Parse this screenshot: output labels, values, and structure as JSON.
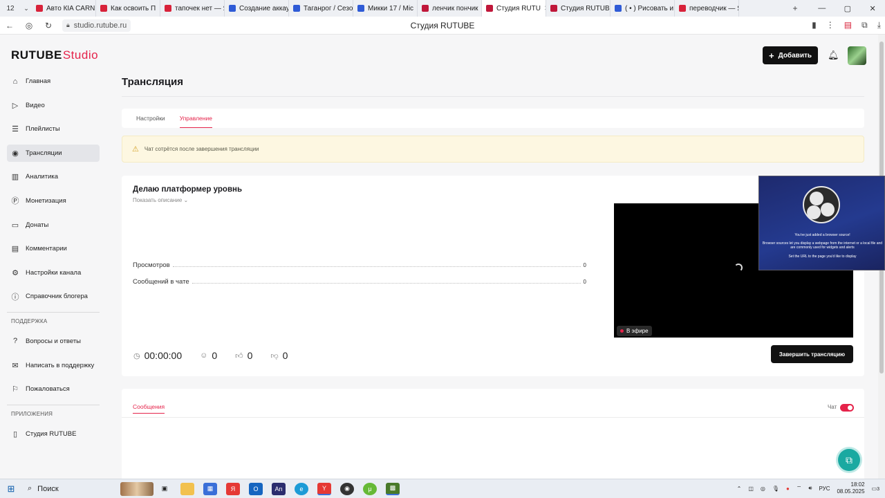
{
  "browser": {
    "tab_count": "12",
    "tabs": [
      {
        "label": "Авто КIA CARNI",
        "color": "#d8223a",
        "active": false
      },
      {
        "label": "Как освоить П",
        "color": "#d8223a",
        "active": false
      },
      {
        "label": "тапочек нет — Я",
        "color": "#d8223a",
        "active": false
      },
      {
        "label": "Создание аккау",
        "color": "#2f5bd6",
        "active": false
      },
      {
        "label": "Таганрог / Сезо",
        "color": "#2f5bd6",
        "active": false
      },
      {
        "label": "Микки 17 / Mic",
        "color": "#2f5bd6",
        "active": false
      },
      {
        "label": "ленчик пончик",
        "color": "#c0173a",
        "active": false
      },
      {
        "label": "Студия RUTU",
        "color": "#c0173a",
        "active": true
      },
      {
        "label": "Студия RUTUBE",
        "color": "#c0173a",
        "active": false
      },
      {
        "label": "( • ) Рисовать и",
        "color": "#2f5bd6",
        "active": false
      },
      {
        "label": "переводчик — Я",
        "color": "#d8223a",
        "active": false
      }
    ],
    "url": "studio.rutube.ru",
    "page_title": "Студия RUTUBE"
  },
  "header": {
    "logo_main": "RUTUBE",
    "logo_studio": "Studio",
    "add_label": "Добавить"
  },
  "sidebar": {
    "items": [
      {
        "label": "Главная",
        "icon": "home-icon",
        "glyph": "⌂"
      },
      {
        "label": "Видео",
        "icon": "video-icon",
        "glyph": "▷"
      },
      {
        "label": "Плейлисты",
        "icon": "playlist-icon",
        "glyph": "☰"
      },
      {
        "label": "Трансляции",
        "icon": "broadcast-icon",
        "glyph": "◉"
      },
      {
        "label": "Аналитика",
        "icon": "analytics-icon",
        "glyph": "▥"
      },
      {
        "label": "Монетизация",
        "icon": "monetization-icon",
        "glyph": "Ⓟ"
      },
      {
        "label": "Донаты",
        "icon": "donate-icon",
        "glyph": "▭"
      },
      {
        "label": "Комментарии",
        "icon": "comments-icon",
        "glyph": "▤"
      },
      {
        "label": "Настройки канала",
        "icon": "settings-icon",
        "glyph": "⚙"
      },
      {
        "label": "Справочник блогера",
        "icon": "info-icon",
        "glyph": "ⓘ"
      }
    ],
    "support_title": "ПОДДЕРЖКА",
    "support_items": [
      {
        "label": "Вопросы и ответы",
        "icon": "help-icon",
        "glyph": "?"
      },
      {
        "label": "Написать в поддержку",
        "icon": "mail-icon",
        "glyph": "✉"
      },
      {
        "label": "Пожаловаться",
        "icon": "flag-icon",
        "glyph": "⚐"
      }
    ],
    "apps_title": "ПРИЛОЖЕНИЯ",
    "apps_items": [
      {
        "label": "Студия RUTUBE",
        "icon": "app-icon",
        "glyph": "▯"
      }
    ]
  },
  "main": {
    "title": "Трансляция",
    "tabs": [
      "Настройки",
      "Управление"
    ],
    "alert": "Чат сотрётся после завершения трансляции",
    "stream_title": "Делаю платформер уровнь",
    "show_description": "Показать описание ⌄",
    "stats": [
      {
        "label": "Просмотров",
        "value": "0"
      },
      {
        "label": "Сообщений в чате",
        "value": "0"
      }
    ],
    "duration": "00:00:00",
    "viewers": "0",
    "likes": "0",
    "dislikes": "0",
    "live_label": "В эфире",
    "end_label": "Завершить трансляцию",
    "chat_tab": "Сообщения",
    "chat_toggle_label": "Чат"
  },
  "obs": {
    "line1": "You've just added a browser source!",
    "line2": "Browser sources let you display a webpage from the internet or a local file and are commonly used for widgets and alerts",
    "line3": "Set the URL to the page you'd like to display"
  },
  "taskbar": {
    "search": "Поиск",
    "lang": "РУС",
    "time": "18:02",
    "date": "08.05.2025",
    "notifications": "3"
  }
}
